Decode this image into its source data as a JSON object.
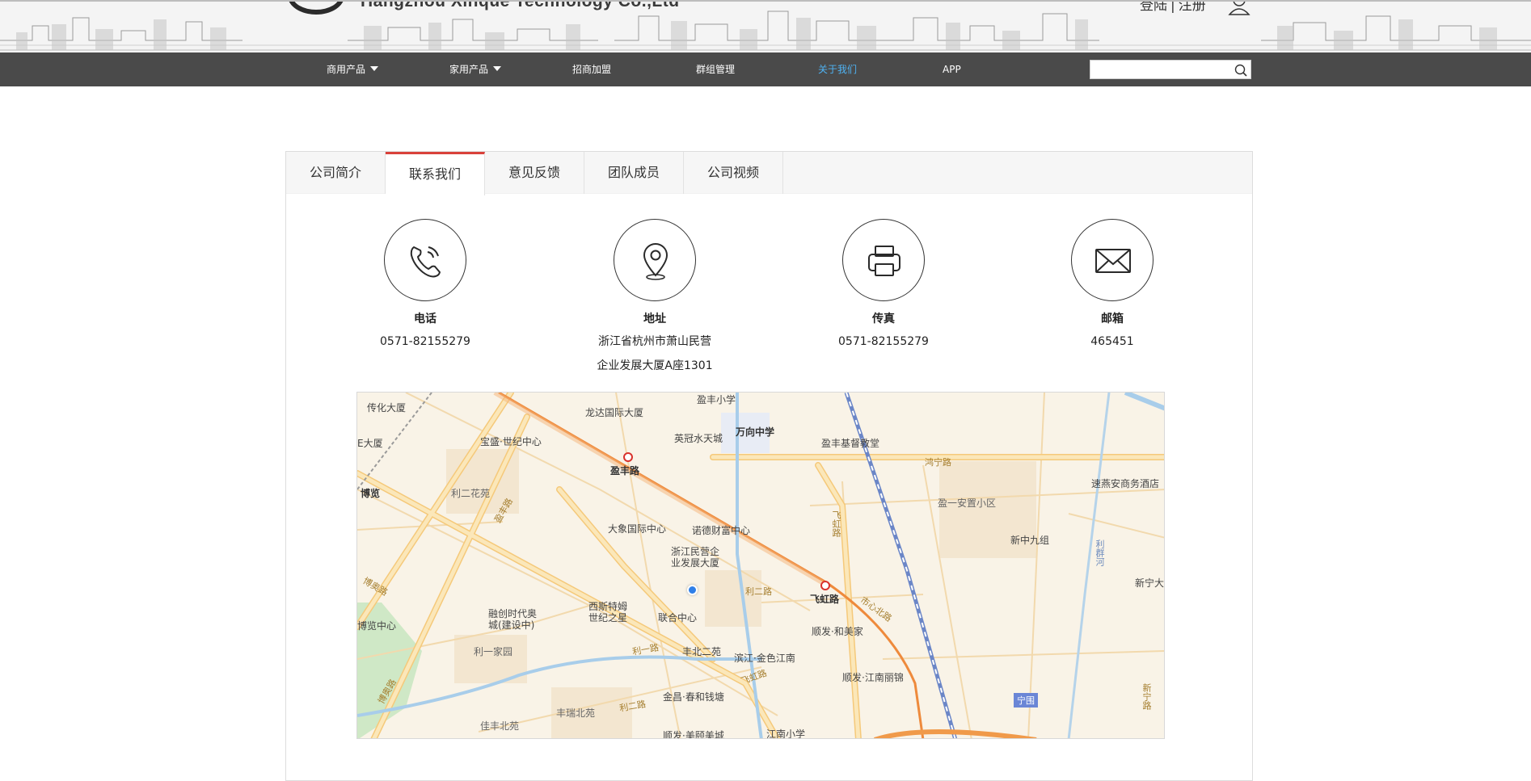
{
  "header": {
    "company_name": "Hangzhou Xinque Technology Co.,Ltd",
    "login_label": "登陆",
    "separator": "|",
    "register_label": "注册"
  },
  "nav": {
    "items": [
      {
        "label": "商用产品",
        "has_dropdown": true
      },
      {
        "label": "家用产品",
        "has_dropdown": true
      },
      {
        "label": "招商加盟"
      },
      {
        "label": "群组管理"
      },
      {
        "label": "关于我们",
        "active": true
      },
      {
        "label": "APP"
      }
    ],
    "search_value": "",
    "active_color": "#4fb2f2",
    "bar_color": "#4a4a4a"
  },
  "tabs": {
    "items": [
      {
        "label": "公司简介"
      },
      {
        "label": "联系我们",
        "active": true
      },
      {
        "label": "意见反馈"
      },
      {
        "label": "团队成员"
      },
      {
        "label": "公司视频"
      }
    ],
    "accent_color": "#d9413a"
  },
  "contact": {
    "phone": {
      "icon": "phone-icon",
      "title": "电话",
      "value": "0571-82155279"
    },
    "address": {
      "icon": "location-pin-icon",
      "title": "地址",
      "line1": "浙江省杭州市萧山民营",
      "line2": "企业发展大厦A座1301"
    },
    "fax": {
      "icon": "printer-icon",
      "title": "传真",
      "value": "0571-82155279"
    },
    "email": {
      "icon": "envelope-icon",
      "title": "邮箱",
      "value": "465451"
    }
  },
  "map": {
    "labels": {
      "chuanhua": "传化大厦",
      "yingfeng_school": "盈丰小学",
      "longda": "龙达国际大厦",
      "wanxiang": "万向中学",
      "yingguan": "英冠水天城",
      "baosheng": "宝盛·世纪中心",
      "x_dasha": "E大厦",
      "yingfeng_church": "盈丰基督教堂",
      "hongning_road": "鸿宁路",
      "yingfeng_road": "盈丰路",
      "bolan": "博览",
      "lier_garden": "利二花苑",
      "sufu_hotel": "速燕安商务酒店",
      "yingyi": "盈一安置小区",
      "xinzhong": "新中九组",
      "dajin": "大象国际中心",
      "nuode": "诺德财富中心",
      "zhejiang_minying": "浙江民营企\n业发展大厦",
      "feihong_road_v": "飞虹路",
      "feihong_station": "飞虹路",
      "xinning": "新宁大",
      "boyu": "博览中心",
      "rongchuang": "融创时代奥\n城(建设中)",
      "xisite": "西斯特姆\n世纪之星",
      "lianhe": "联合中心",
      "lier_road": "利二路",
      "shunfa_he": "顺发·和美家",
      "lier_yijia": "利一家园",
      "fengbei": "丰北二苑",
      "binjiang": "滨江·金色江南",
      "shunfa_jn": "顺发·江南丽锦",
      "ningwei": "宁围",
      "jinchang": "金昌·春和钱塘",
      "fengrui": "丰瑞北苑",
      "jiafeng": "佳丰北苑",
      "shunfa_mei": "顺发·美颐美城",
      "jiangnan_school": "江南小学",
      "lier_road2": "利一路",
      "feihong_road2": "飞虹路",
      "shixin_road": "市心北路",
      "bolan_road": "博奥路",
      "yingfeng_v": "盈丰路",
      "boao_road2": "博奥路",
      "lier_road3": "利二路",
      "xinning_road": "新宁路",
      "qunan_river": "利群河"
    }
  }
}
